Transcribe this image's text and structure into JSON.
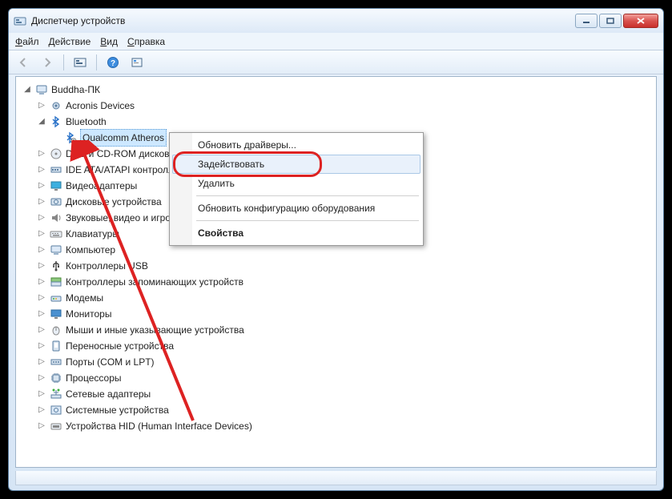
{
  "window": {
    "title": "Диспетчер устройств"
  },
  "menu": {
    "file": "Файл",
    "action": "Действие",
    "view": "Вид",
    "help": "Справка"
  },
  "tree": {
    "root": "Buddha-ПК",
    "items": [
      {
        "label": "Acronis Devices",
        "icon": "gear"
      },
      {
        "label": "Bluetooth",
        "icon": "bluetooth",
        "expanded": true,
        "children": [
          {
            "label": "Qualcomm Atheros",
            "icon": "bluetooth-disabled",
            "selected": true
          }
        ]
      },
      {
        "label": "DVD и CD-ROM дисководы",
        "icon": "disc"
      },
      {
        "label": "IDE ATA/ATAPI контроллеры",
        "icon": "ide"
      },
      {
        "label": "Видеоадаптеры",
        "icon": "display"
      },
      {
        "label": "Дисковые устройства",
        "icon": "hdd"
      },
      {
        "label": "Звуковые, видео и игровые устройства",
        "icon": "speaker"
      },
      {
        "label": "Клавиатуры",
        "icon": "keyboard"
      },
      {
        "label": "Компьютер",
        "icon": "computer"
      },
      {
        "label": "Контроллеры USB",
        "icon": "usb"
      },
      {
        "label": "Контроллеры запоминающих устройств",
        "icon": "storage"
      },
      {
        "label": "Модемы",
        "icon": "modem"
      },
      {
        "label": "Мониторы",
        "icon": "monitor"
      },
      {
        "label": "Мыши и иные указывающие устройства",
        "icon": "mouse"
      },
      {
        "label": "Переносные устройства",
        "icon": "portable"
      },
      {
        "label": "Порты (COM и LPT)",
        "icon": "port"
      },
      {
        "label": "Процессоры",
        "icon": "cpu"
      },
      {
        "label": "Сетевые адаптеры",
        "icon": "network"
      },
      {
        "label": "Системные устройства",
        "icon": "system"
      },
      {
        "label": "Устройства HID (Human Interface Devices)",
        "icon": "hid"
      }
    ]
  },
  "context_menu": {
    "update_drivers": "Обновить драйверы...",
    "enable": "Задействовать",
    "delete": "Удалить",
    "scan_hardware": "Обновить конфигурацию оборудования",
    "properties": "Свойства"
  }
}
